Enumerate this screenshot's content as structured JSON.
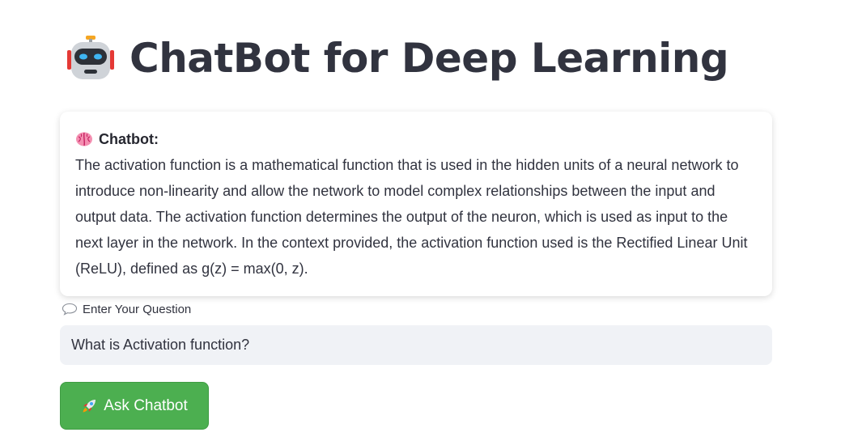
{
  "header": {
    "title": "ChatBot for Deep Learning",
    "icon": "robot-icon"
  },
  "answer_card": {
    "label": "Chatbot:",
    "icon": "brain-icon",
    "text": "The activation function is a mathematical function that is used in the hidden units of a neural network to introduce non-linearity and allow the network to model complex relationships between the input and output data. The activation function determines the output of the neuron, which is used as input to the next layer in the network. In the context provided, the activation function used is the Rectified Linear Unit (ReLU), defined as g(z) = max(0, z)."
  },
  "question": {
    "label": "Enter Your Question",
    "icon": "speech-bubble-icon",
    "value": "What is Activation function?"
  },
  "ask_button": {
    "label": "Ask Chatbot",
    "icon": "rocket-icon",
    "color": "#4caf50"
  }
}
